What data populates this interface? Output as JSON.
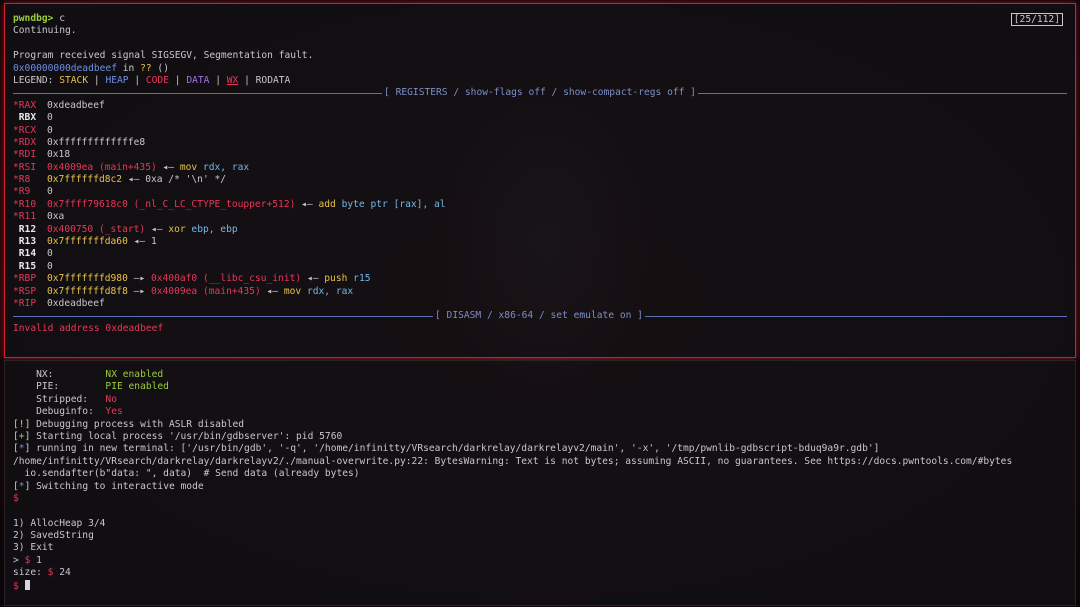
{
  "counter": "[25/112]",
  "gdb": {
    "prompt": "pwndbg>",
    "command": " c",
    "continuing": "Continuing.",
    "signal": "Program received signal SIGSEGV, Segmentation fault.",
    "fault_addr": "0x00000000deadbeef",
    "fault_in": " in ",
    "fault_fn": "??",
    "fault_args": " ()",
    "legend": {
      "label": "LEGEND: ",
      "stack": "STACK",
      "heap": "HEAP",
      "code": "CODE",
      "data": "DATA",
      "nx": "WX",
      "rodata": "RODATA",
      "sep": " | "
    },
    "registers_header": "[ REGISTERS / show-flags off / show-compact-regs off ]",
    "registers": [
      {
        "name": "*RAX",
        "value": "0xdeadbeef"
      },
      {
        "name": " RBX",
        "value": "0"
      },
      {
        "name": "*RCX",
        "value": "0"
      },
      {
        "name": "*RDX",
        "value": "0xfffffffffffffe8"
      },
      {
        "name": "*RDI",
        "value": "0x18"
      },
      {
        "name": "*RSI",
        "addr": "0x4009ea (main+435)",
        "arrow": " ◂— ",
        "ins": "mov",
        "ops": " rdx, rax"
      },
      {
        "name": "*R8",
        "addr": "0x7ffffffd8c2",
        "arrow": " ◂— ",
        "value": "0xa /* '\\n' */"
      },
      {
        "name": "*R9",
        "value": "0"
      },
      {
        "name": "*R10",
        "addr": "0x7ffff79618c0 (_nl_C_LC_CTYPE_toupper+512)",
        "arrow": " ◂— ",
        "ins": "add",
        "ops": " byte ptr [rax], al"
      },
      {
        "name": "*R11",
        "value": "0xa"
      },
      {
        "name": " R12",
        "addr": "0x400750 (_start)",
        "arrow": " ◂— ",
        "ins": "xor",
        "ops": " ebp, ebp"
      },
      {
        "name": " R13",
        "addr": "0x7fffffffda60",
        "arrow": " ◂— ",
        "value": "1"
      },
      {
        "name": " R14",
        "value": "0"
      },
      {
        "name": " R15",
        "value": "0"
      },
      {
        "name": "*RBP",
        "addr": "0x7fffffffd980",
        "arrow": " —▸ ",
        "addr2": "0x400af0 (__libc_csu_init)",
        "arrow2": " ◂— ",
        "ins": "push",
        "ops": " r15"
      },
      {
        "name": "*RSP",
        "addr": "0x7fffffffd8f8",
        "arrow": " —▸ ",
        "addr2": "0x4009ea (main+435)",
        "arrow2": " ◂— ",
        "ins": "mov",
        "ops": " rdx, rax"
      },
      {
        "name": "*RIP",
        "value": "0xdeadbeef"
      }
    ],
    "disasm_header": "[ DISASM / x86-64 / set emulate on ]",
    "invalid": "Invalid address 0xdeadbeef"
  },
  "term": {
    "checksec": [
      {
        "key": "    NX:         ",
        "value": "NX enabled",
        "good": true
      },
      {
        "key": "    PIE:        ",
        "value": "PIE enabled",
        "good": true
      },
      {
        "key": "    Stripped:   ",
        "value": "No",
        "good": false
      },
      {
        "key": "    Debuginfo:  ",
        "value": "Yes",
        "good": false
      }
    ],
    "warn_tag": "!",
    "warn_text": " Debugging process with ASLR disabled",
    "plus_tag": "+",
    "plus_text": " Starting local process '/usr/bin/gdbserver': pid 5760",
    "star_tag": "*",
    "running_text": " running in new terminal: ['/usr/bin/gdb', '-q', '/home/infinitty/VRsearch/darkrelay/darkrelayv2/main', '-x', '/tmp/pwnlib-gdbscript-bduq9a9r.gdb']",
    "bytes_warning": "/home/infinitty/VRsearch/darkrelay/darkrelayv2/./manual-overwrite.py:22: BytesWarning: Text is not bytes; assuming ASCII, no guarantees. See https://docs.pwntools.com/#bytes",
    "sendafter": "  io.sendafter(b\"data: \", data)  # Send data (already bytes)",
    "interactive_text": " Switching to interactive mode",
    "dollar": "$",
    "menu": [
      "1) AllocHeap 3/4",
      "2) SavedString",
      "3) Exit"
    ],
    "choice_prefix": "> ",
    "choice_value": "1",
    "size_prefix": "size: ",
    "size_value": "24"
  },
  "colors": {
    "border_active": "#d21e2e",
    "register_changed": "#e8365a",
    "address": "#e8365a",
    "instruction": "#e8c14a",
    "separator": "#7e8ec9"
  }
}
